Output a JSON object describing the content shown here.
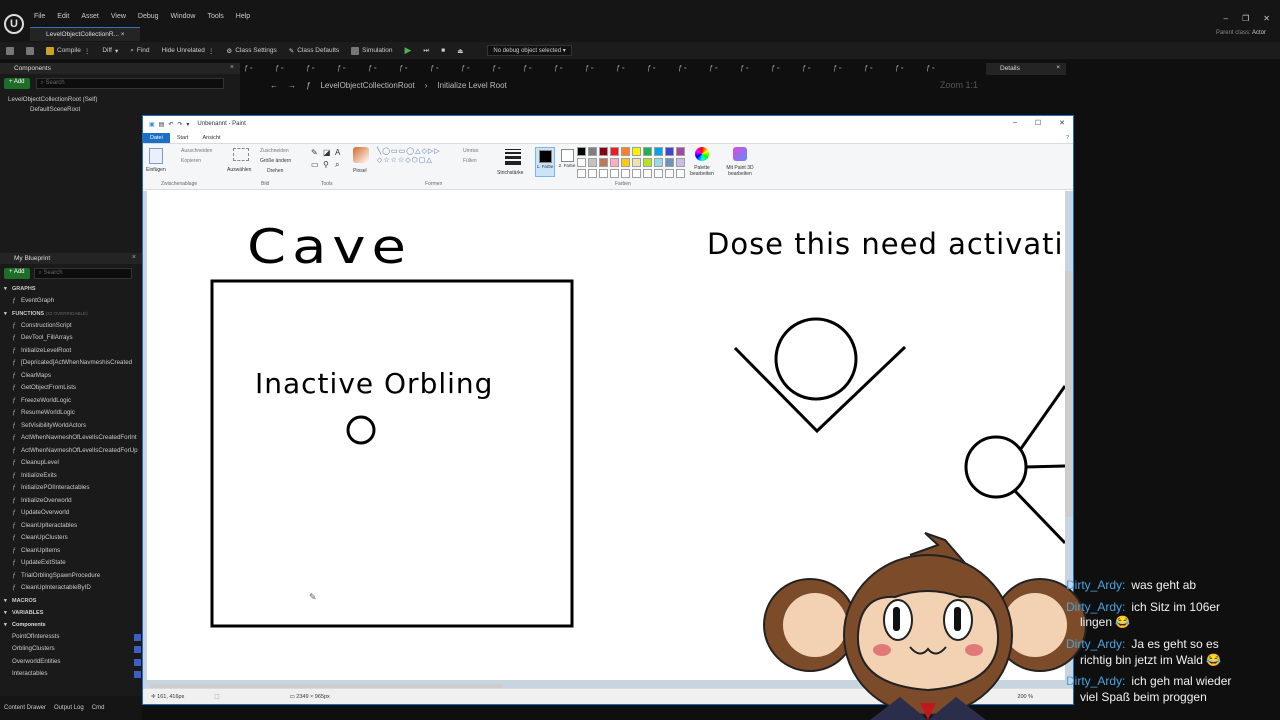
{
  "ue": {
    "menu": [
      "File",
      "Edit",
      "Asset",
      "View",
      "Debug",
      "Window",
      "Tools",
      "Help"
    ],
    "tab_title": "LevelObjectCollectionR...",
    "parent_class_label": "Parent class:",
    "parent_class_value": "Actor",
    "toolbar": {
      "compile": "Compile",
      "diff": "Diff",
      "find": "Find",
      "hide_unrelated": "Hide Unrelated",
      "class_settings": "Class Settings",
      "class_defaults": "Class Defaults",
      "simulation": "Simulation",
      "debug_select": "No debug object selected"
    },
    "components": {
      "tab": "Components",
      "add": "+ Add",
      "search_placeholder": "Search",
      "root": "LevelObjectCollectionRoot (Self)",
      "child": "DefaultSceneRoot"
    },
    "graph": {
      "breadcrumb_root": "LevelObjectCollectionRoot",
      "breadcrumb_fn": "Initialize Level Root",
      "zoom": "Zoom 1:1"
    },
    "details_tab": "Details",
    "my_blueprint": {
      "tab": "My Blueprint",
      "add": "+ Add",
      "search_placeholder": "Search",
      "graphs_header": "GRAPHS",
      "event_graph": "EventGraph",
      "functions_header": "FUNCTIONS",
      "functions_note": "(33 OVERRIDABLE)",
      "functions": [
        "ConstructionScript",
        "DevTool_FillArrays",
        "InitializeLevelRoot",
        "[Depricated]ActWhenNavmeshisCreated",
        "ClearMaps",
        "GetObjectFromLists",
        "FreezeWorldLogic",
        "ResumeWorldLogic",
        "SetVisibilityWorldActors",
        "ActWhenNavmeshOfLevelIsCreatedForInt",
        "ActWhenNavmeshOfLevelIsCreatedForUp",
        "CleanupLevel",
        "InitializeExits",
        "InitializePOIInteractables",
        "InitializeOverworld",
        "UpdateOverworld",
        "CleanUpIteractables",
        "CleanUpClusters",
        "CleanUpItems",
        "UpdateExitState",
        "TrialOrblingSpawnProcedure",
        "CleanUpInteractableByID"
      ],
      "macros_header": "MACROS",
      "variables_header": "VARIABLES",
      "components_header": "Components",
      "variables": [
        "PointOfInteressts",
        "OrblingClusters",
        "OverworldEntities",
        "Interactables"
      ]
    },
    "bottom": [
      "Content Drawer",
      "Output Log",
      "Cmd"
    ]
  },
  "paint": {
    "title": "Unbenannt - Paint",
    "tabs": [
      "Datei",
      "Start",
      "Ansicht"
    ],
    "ribbon": {
      "clipboard_label": "Zwischenablage",
      "paste": "Einfügen",
      "cut": "Ausschneiden",
      "copy": "Kopieren",
      "select": "Auswählen",
      "crop": "Zuschneiden",
      "resize": "Größe ändern",
      "rotate": "Drehen",
      "image_label": "Bild",
      "tools_label": "Tools",
      "brushes": "Pinsel",
      "shapes_label": "Formen",
      "outline": "Umriss",
      "fill": "Füllen",
      "size": "Strichstärke",
      "color1": "1. Farbe",
      "color2": "2. Farbe",
      "colors_label": "Farben",
      "edit_colors": "Palette bearbeiten",
      "paint3d": "Mit Paint 3D bearbeiten",
      "palette": [
        "#000000",
        "#7f7f7f",
        "#880015",
        "#ed1c24",
        "#ff7f27",
        "#fff200",
        "#22b14c",
        "#00a2e8",
        "#3f48cc",
        "#a349a4",
        "#ffffff",
        "#c3c3c3",
        "#b97a57",
        "#ffaec9",
        "#ffc90e",
        "#efe4b0",
        "#b5e61d",
        "#99d9ea",
        "#7092be",
        "#c8bfe7"
      ]
    },
    "canvas_text": {
      "cave": "Cave",
      "inactive": "Inactive Orbling",
      "question": "Dose this need activatio"
    },
    "status": {
      "cursor_pos": "161, 416px",
      "canvas_size": "2349 × 965px",
      "zoom": "200 %"
    }
  },
  "chat": [
    {
      "user": "Dirty_Ardy:",
      "msg": "was geht ab"
    },
    {
      "user": "Dirty_Ardy:",
      "msg": "ich Sitz im 106er"
    },
    {
      "user": "",
      "msg": "lingen 😂"
    },
    {
      "user": "Dirty_Ardy:",
      "msg": "Ja es geht so es"
    },
    {
      "user": "",
      "msg": "richtig bin jetzt im Wald 😂"
    },
    {
      "user": "Dirty_Ardy:",
      "msg": "ich geh mal wieder"
    },
    {
      "user": "",
      "msg": "viel Spaß beim proggen"
    }
  ]
}
